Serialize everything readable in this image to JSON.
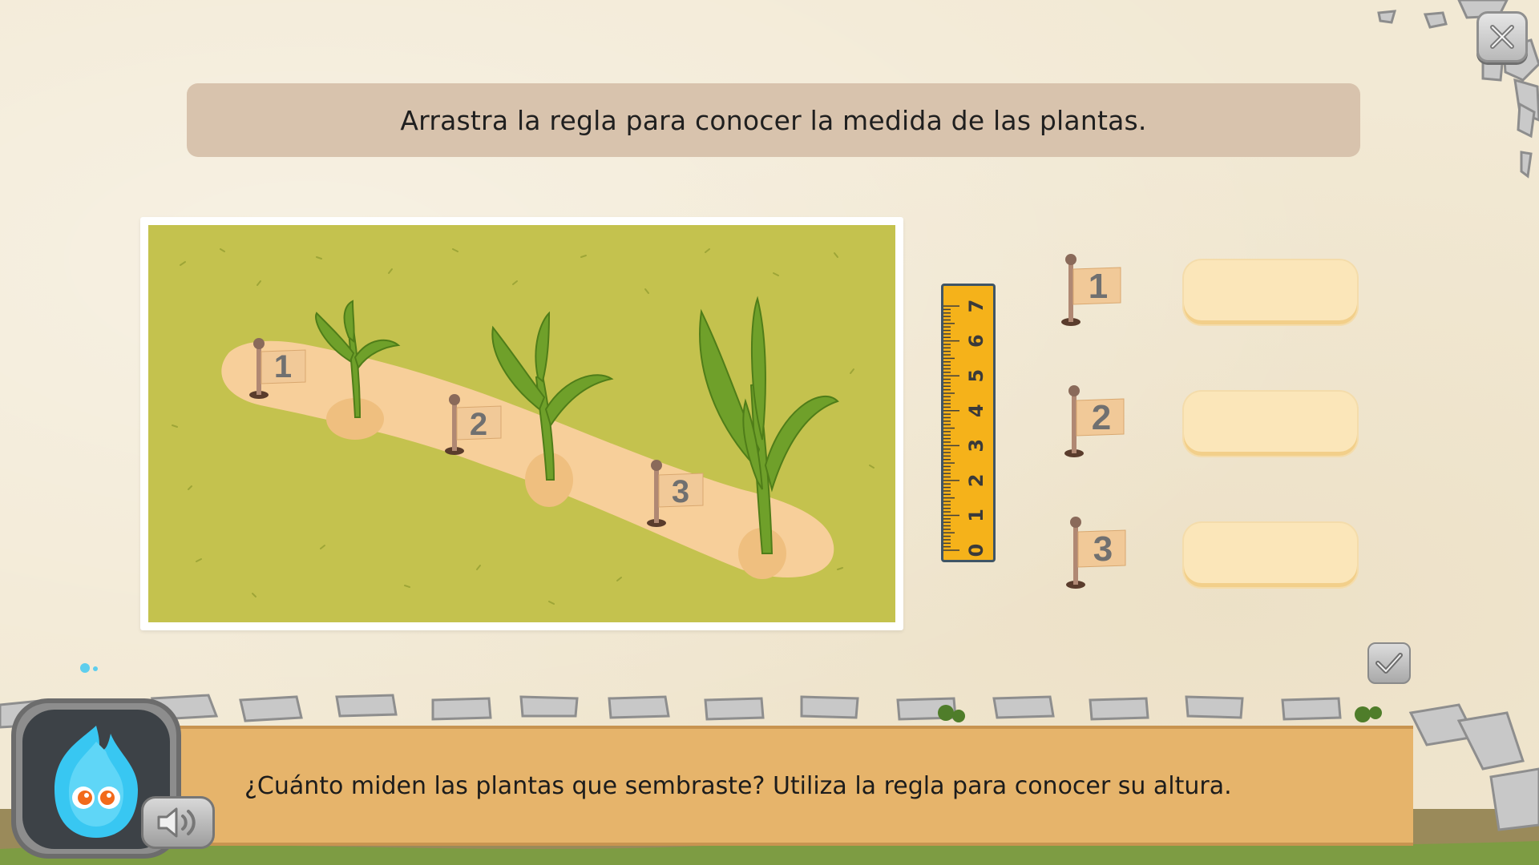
{
  "instruction": {
    "text": "Arrastra la regla para conocer la medida de las plantas."
  },
  "scene": {
    "flags": [
      {
        "label": "1"
      },
      {
        "label": "2"
      },
      {
        "label": "3"
      }
    ]
  },
  "ruler": {
    "numbers": [
      "0",
      "1",
      "2",
      "3",
      "4",
      "5",
      "6",
      "7"
    ],
    "color": "#f5b21a"
  },
  "answers": [
    {
      "flag_label": "1",
      "value": ""
    },
    {
      "flag_label": "2",
      "value": ""
    },
    {
      "flag_label": "3",
      "value": ""
    }
  ],
  "dialog": {
    "text": "¿Cuánto miden las plantas que sembraste? Utiliza la regla para conocer su altura."
  },
  "icons": {
    "close": "close-icon",
    "check": "check-icon",
    "sound": "speaker-icon",
    "mascot": "blue-flame-mascot"
  },
  "colors": {
    "background": "#f2e9d4",
    "banner": "#d8c3ad",
    "grass": "#c4c24e",
    "path": "#f7cf9a",
    "answer_box": "#fbe6b9",
    "dialog_board": "#e6b46b",
    "mascot_blue": "#38c7f2"
  }
}
